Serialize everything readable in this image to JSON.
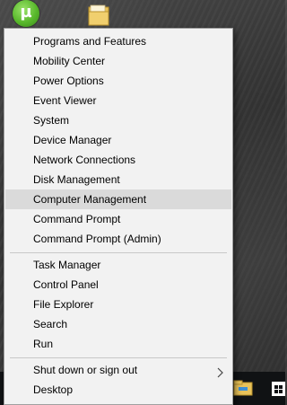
{
  "desktop": {
    "icons": [
      "utorrent-icon",
      "folder-icon"
    ]
  },
  "menu": {
    "groups": [
      [
        {
          "label": "Programs and Features"
        },
        {
          "label": "Mobility Center"
        },
        {
          "label": "Power Options"
        },
        {
          "label": "Event Viewer"
        },
        {
          "label": "System"
        },
        {
          "label": "Device Manager"
        },
        {
          "label": "Network Connections"
        },
        {
          "label": "Disk Management"
        },
        {
          "label": "Computer Management",
          "highlighted": true
        },
        {
          "label": "Command Prompt"
        },
        {
          "label": "Command Prompt (Admin)"
        }
      ],
      [
        {
          "label": "Task Manager"
        },
        {
          "label": "Control Panel"
        },
        {
          "label": "File Explorer"
        },
        {
          "label": "Search"
        },
        {
          "label": "Run"
        }
      ],
      [
        {
          "label": "Shut down or sign out",
          "submenu_icon": "chevron-right-icon"
        },
        {
          "label": "Desktop"
        }
      ]
    ]
  },
  "taskbar": {
    "icons": [
      "file-explorer-icon",
      "store-icon"
    ]
  },
  "colors": {
    "menu_background": "#f2f2f2",
    "highlight": "#dadada",
    "taskbar": "#101214"
  }
}
